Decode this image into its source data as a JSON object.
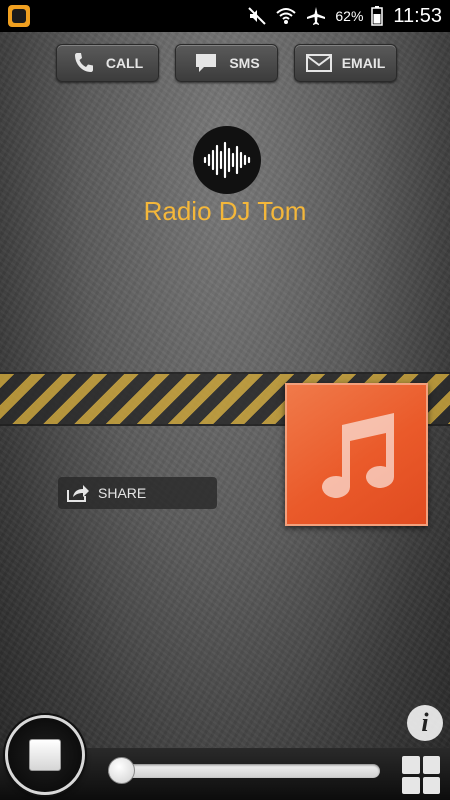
{
  "status_bar": {
    "battery_percent": "62%",
    "time": "11:53"
  },
  "contact_buttons": {
    "call_label": "CALL",
    "sms_label": "SMS",
    "email_label": "EMAIL"
  },
  "station": {
    "name": "Radio DJ Tom"
  },
  "share": {
    "label": "SHARE"
  },
  "info": {
    "label": "i"
  },
  "player": {
    "state": "playing",
    "volume": 0.0
  },
  "colors": {
    "title": "#f4b73a",
    "album_art": "#ea5a2a",
    "notification_icon": "#f0a020"
  },
  "icons": [
    "app-notification-icon",
    "mute-icon",
    "wifi-icon",
    "airplane-mode-icon",
    "battery-icon",
    "phone-icon",
    "chat-bubble-icon",
    "envelope-icon",
    "sound-wave-icon",
    "music-note-icon",
    "share-icon",
    "info-icon",
    "stop-icon",
    "grid-menu-icon"
  ]
}
